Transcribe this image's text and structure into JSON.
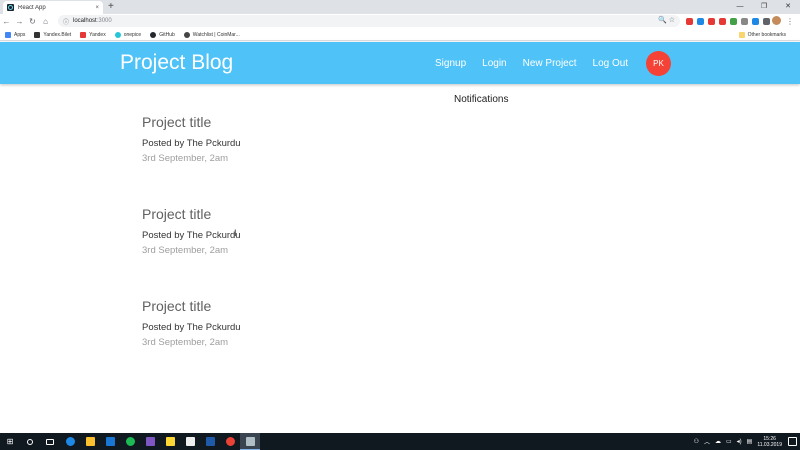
{
  "browser": {
    "tab_title": "React App",
    "tab_close": "×",
    "new_tab": "+",
    "win_min": "—",
    "win_max": "❐",
    "win_close": "✕",
    "url_host": "localhost",
    "url_port": ":3000",
    "nav_icons": [
      "arrow-left-icon",
      "arrow-right-icon",
      "reload-icon",
      "home-icon"
    ],
    "bookmarks": [
      {
        "label": "Apps",
        "icon_color": "#4285f4"
      },
      {
        "label": "Yandex.Bilet",
        "icon_color": "#333333"
      },
      {
        "label": "Yandex",
        "icon_color": "#e53935"
      },
      {
        "label": "onepice",
        "icon_color": "#26c6da"
      },
      {
        "label": "GitHub",
        "icon_color": "#24292e"
      },
      {
        "label": "Watchlist | CoinMar...",
        "icon_color": "#444444"
      }
    ],
    "other_bookmarks": "Other bookmarks",
    "extension_colors": [
      "#e53935",
      "#1e88e5",
      "#e53935",
      "#e53935",
      "#43a047",
      "#888888",
      "#1e88e5",
      "#5f6368"
    ]
  },
  "app": {
    "brand": "Project Blog",
    "nav_links": [
      "Signup",
      "Login",
      "New Project",
      "Log Out"
    ],
    "avatar_initials": "PK",
    "notifications_title": "Notifications",
    "projects": [
      {
        "title": "Project title",
        "author": "Posted by The Pckurdu",
        "date": "3rd September, 2am"
      },
      {
        "title": "Project title",
        "author": "Posted by The Pckurdu",
        "date": "3rd September, 2am"
      },
      {
        "title": "Project title",
        "author": "Posted by The Pckurdu",
        "date": "3rd September, 2am"
      }
    ],
    "colors": {
      "navbar": "#4fc3f7",
      "avatar": "#f44336"
    }
  },
  "taskbar": {
    "apps": [
      {
        "name": "search-icon",
        "color": "#ffffff"
      },
      {
        "name": "task-view-icon",
        "color": "#ffffff"
      },
      {
        "name": "edge-icon",
        "color": "#1e88e5"
      },
      {
        "name": "file-explorer-icon",
        "color": "#fbc02d"
      },
      {
        "name": "visual-studio-code-icon",
        "color": "#1976d2"
      },
      {
        "name": "spotify-icon",
        "color": "#1db954"
      },
      {
        "name": "visual-studio-icon",
        "color": "#7e57c2"
      },
      {
        "name": "app-icon",
        "color": "#fdd835"
      },
      {
        "name": "notepad-icon",
        "color": "#eeeeee"
      },
      {
        "name": "word-icon",
        "color": "#1e5aa8"
      },
      {
        "name": "chrome-icon",
        "color": "#ea4335"
      },
      {
        "name": "snipping-tool-icon",
        "color": "#b0bec5"
      }
    ],
    "time": "15:26",
    "date": "11.03.2019"
  }
}
